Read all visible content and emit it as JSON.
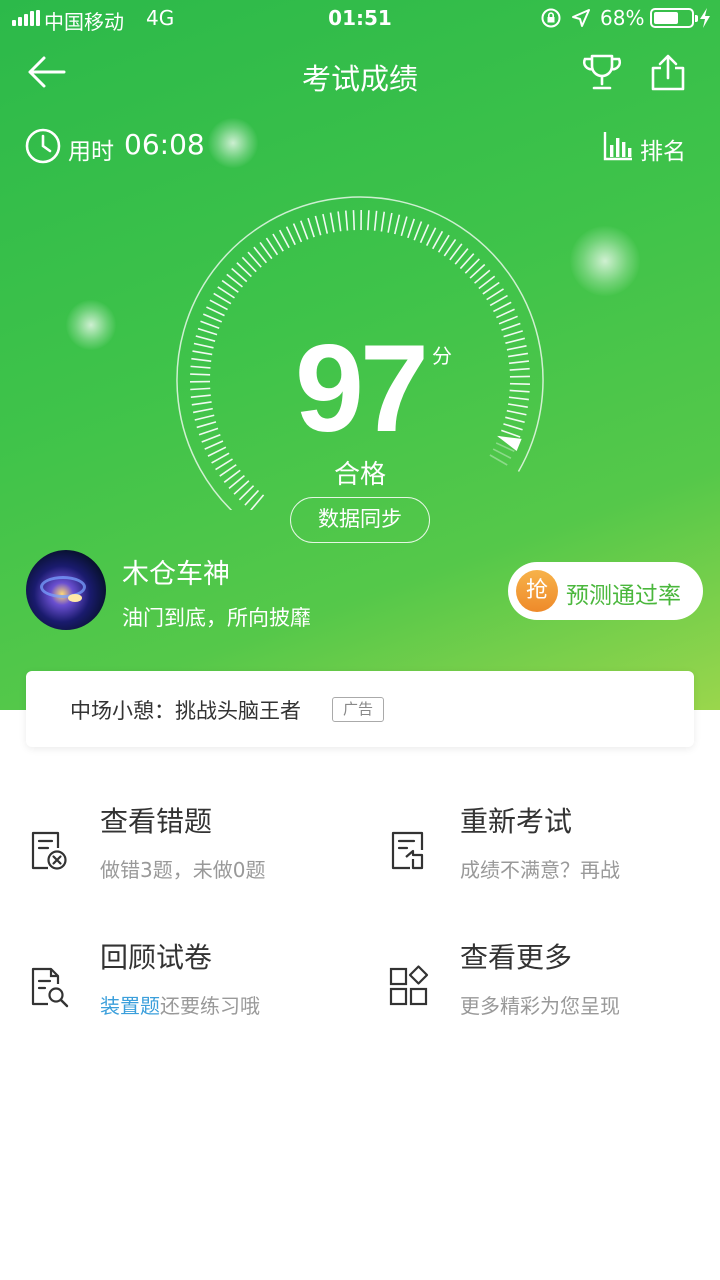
{
  "status_bar": {
    "carrier": "中国移动",
    "network": "4G",
    "time": "01:51",
    "battery_percent": "68%",
    "battery_level": 0.68
  },
  "nav": {
    "title": "考试成绩",
    "back_icon": "arrow-left-icon",
    "trophy_icon": "trophy-icon",
    "share_icon": "share-icon"
  },
  "stats": {
    "time_label": "用时",
    "time_value": "06:08",
    "rank_label": "排名"
  },
  "result": {
    "score": "97",
    "score_unit": "分",
    "status": "合格",
    "score_fraction": 0.97,
    "sync_label": "数据同步"
  },
  "user": {
    "name": "木仓车神",
    "motto": "油门到底，所向披靡"
  },
  "predict": {
    "badge": "抢",
    "label": "预测通过率"
  },
  "ad": {
    "text": "中场小憩：挑战头脑王者",
    "tag": "广告"
  },
  "actions": [
    {
      "title": "查看错题",
      "subtitle": "做错3题，未做0题",
      "icon": "wrong-answers-icon"
    },
    {
      "title": "重新考试",
      "subtitle": "成绩不满意？再战",
      "icon": "retake-exam-icon"
    },
    {
      "title": "回顾试卷",
      "subtitle_highlight": "装置题",
      "subtitle_rest": "还要练习哦",
      "icon": "review-paper-icon"
    },
    {
      "title": "查看更多",
      "subtitle": "更多精彩为您呈现",
      "icon": "more-grid-icon"
    }
  ],
  "colors": {
    "hero_start": "#2cb94a",
    "hero_end": "#9ad64c",
    "accent_green": "#4ab73c",
    "highlight_blue": "#3b9fdb",
    "badge_orange": "#f0962e"
  }
}
